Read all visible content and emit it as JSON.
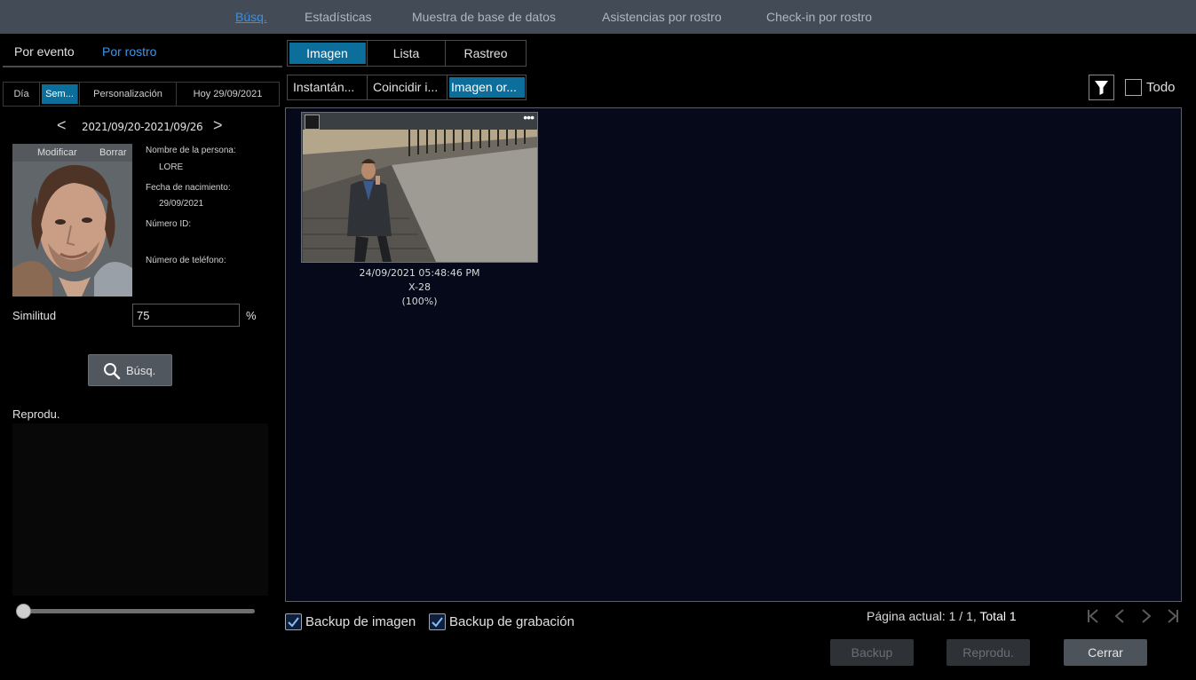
{
  "topnav": {
    "items": [
      "Búsq.",
      "Estadísticas",
      "Muestra de base de datos",
      "Asistencias por rostro",
      "Check-in por rostro"
    ],
    "active_index": 0
  },
  "left": {
    "mode_tabs": [
      "Por evento",
      "Por rostro"
    ],
    "mode_active": 1,
    "range_tabs": [
      "Día",
      "Sem...",
      "Personalización",
      "Hoy 29/09/2021"
    ],
    "range_active": 1,
    "date_range": "2021/09/20-2021/09/26",
    "prev_arrow": "<",
    "next_arrow": ">",
    "face_card": {
      "modify_label": "Modificar",
      "delete_label": "Borrar"
    },
    "person": {
      "name_label": "Nombre de la persona:",
      "name_value": "LORE",
      "dob_label": "Fecha de nacimiento:",
      "dob_value": "29/09/2021",
      "id_label": "Número ID:",
      "id_value": "",
      "phone_label": "Número de teléfono:",
      "phone_value": ""
    },
    "similarity_label": "Similitud",
    "similarity_value": "75",
    "similarity_unit": "%",
    "search_label": "Búsq.",
    "playback_label": "Reprodu.",
    "playback_progress": 0
  },
  "main": {
    "view_tabs": [
      "Imagen",
      "Lista",
      "Rastreo"
    ],
    "view_active": 0,
    "sub_tabs": [
      "Instantán...",
      "Coincidir i...",
      "Imagen or..."
    ],
    "sub_active": 2,
    "todo_label": "Todo",
    "results": [
      {
        "timestamp": "24/09/2021 05:48:46 PM",
        "channel": "X-28",
        "similarity": "(100%)",
        "more": "•••"
      }
    ],
    "backup_image_label": "Backup de imagen",
    "backup_image_checked": true,
    "backup_record_label": "Backup de grabación",
    "backup_record_checked": true,
    "page_prefix": "Página actual: 1 / 1, ",
    "page_total": "Total 1",
    "buttons": {
      "backup": "Backup",
      "playback": "Reprodu.",
      "close": "Cerrar"
    }
  },
  "colors": {
    "accent": "#0c6e9a",
    "link": "#3b8fe0",
    "topbar": "#424b56",
    "results_bg": "#06091a"
  }
}
